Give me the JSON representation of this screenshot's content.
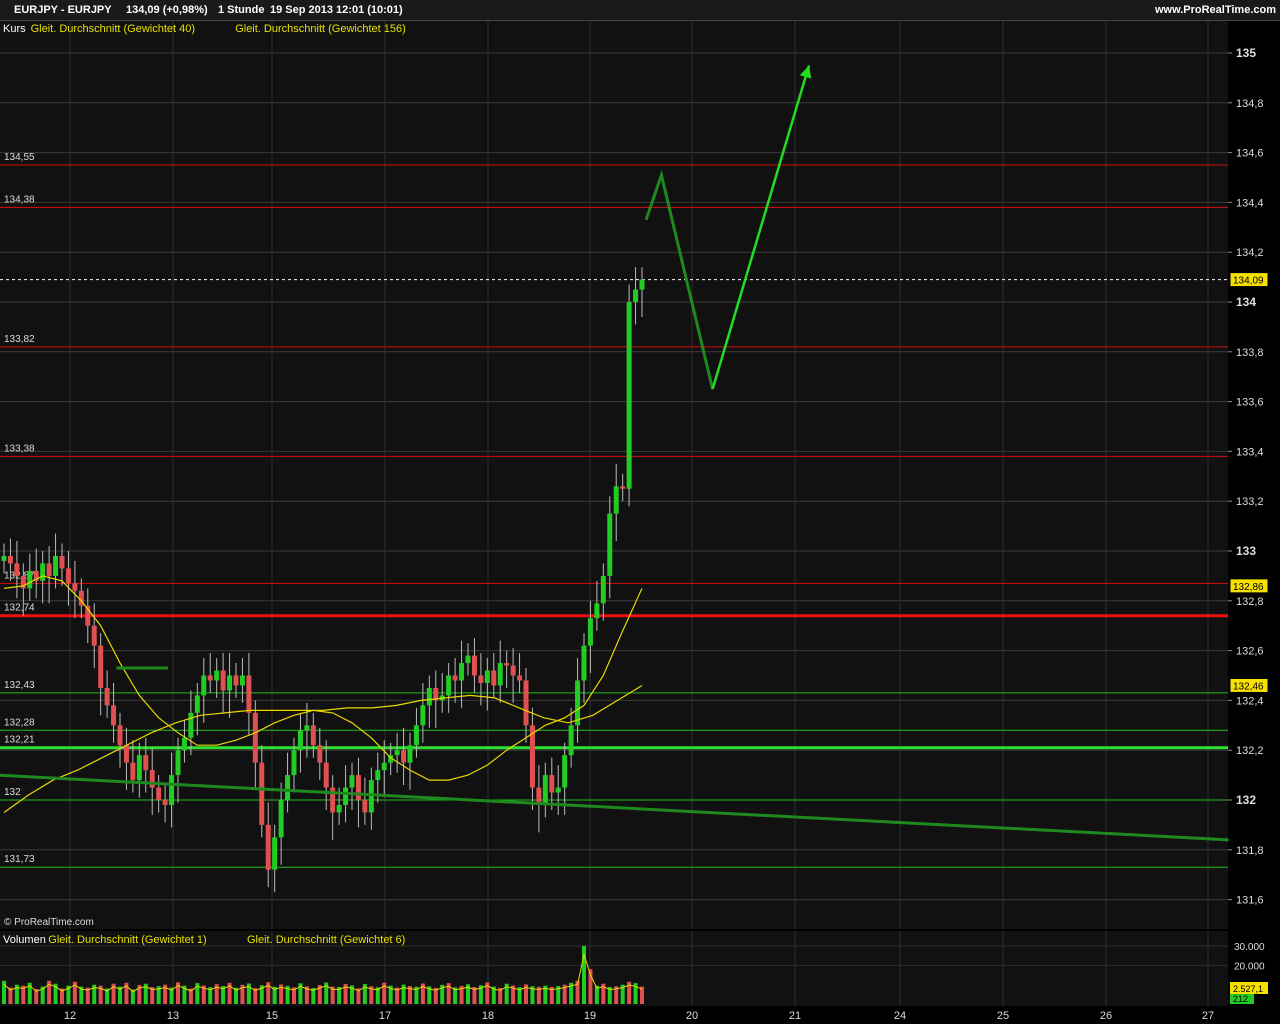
{
  "header": {
    "symbol": "EURJPY - EURJPY",
    "quote": "134,09 (+0,98%)",
    "period": "1 Stunde",
    "datetime": "19 Sep 2013 12:01 (10:01)",
    "brand": "www.ProRealTime.com"
  },
  "copyright": "© ProRealTime.com",
  "price_panel": {
    "legend": [
      {
        "text": "Kurs",
        "color": "#ffffff"
      },
      {
        "text": "Gleit. Durchschnitt (Gewichtet 40)",
        "color": "#e8e000"
      },
      {
        "text": "Gleit. Durchschnitt (Gewichtet 156)",
        "color": "#e8e000"
      }
    ],
    "y_ticks": [
      {
        "v": 135,
        "label": "135",
        "major": true
      },
      {
        "v": 134.8,
        "label": "134,8"
      },
      {
        "v": 134.6,
        "label": "134,6"
      },
      {
        "v": 134.4,
        "label": "134,4"
      },
      {
        "v": 134.2,
        "label": "134,2"
      },
      {
        "v": 134,
        "label": "134",
        "major": true
      },
      {
        "v": 133.8,
        "label": "133,8"
      },
      {
        "v": 133.6,
        "label": "133,6"
      },
      {
        "v": 133.4,
        "label": "133,4"
      },
      {
        "v": 133.2,
        "label": "133,2"
      },
      {
        "v": 133,
        "label": "133",
        "major": true
      },
      {
        "v": 132.8,
        "label": "132,8"
      },
      {
        "v": 132.6,
        "label": "132,6"
      },
      {
        "v": 132.4,
        "label": "132,4"
      },
      {
        "v": 132.2,
        "label": "132,2"
      },
      {
        "v": 132,
        "label": "132",
        "major": true
      },
      {
        "v": 131.8,
        "label": "131,8"
      },
      {
        "v": 131.6,
        "label": "131,6"
      }
    ],
    "price_tags": [
      {
        "v": 134.09,
        "label": "134,09",
        "bg": "#f5e000"
      },
      {
        "v": 132.86,
        "label": "132,86",
        "bg": "#f5e000"
      },
      {
        "v": 132.46,
        "label": "132,46",
        "bg": "#f5e000"
      }
    ],
    "current_price": 134.09
  },
  "volume_panel": {
    "legend": [
      {
        "text": "Volumen",
        "color": "#ffffff"
      },
      {
        "text": "Gleit. Durchschnitt (Gewichtet 1)",
        "color": "#e8e000"
      },
      {
        "text": "Gleit. Durchschnitt (Gewichtet 6)",
        "color": "#e8e000"
      }
    ],
    "y_ticks": [
      {
        "v": 30000,
        "label": "30.000"
      },
      {
        "v": 20000,
        "label": "20.000"
      }
    ],
    "tags": [
      "2.527,1",
      "212"
    ]
  },
  "x_axis": [
    {
      "label": "12",
      "day": 12
    },
    {
      "label": "13",
      "day": 13
    },
    {
      "label": "15",
      "day": 15
    },
    {
      "label": "17",
      "day": 17
    },
    {
      "label": "18",
      "day": 18
    },
    {
      "label": "19",
      "day": 19
    },
    {
      "label": "20",
      "day": 20
    },
    {
      "label": "21",
      "day": 21
    },
    {
      "label": "24",
      "day": 24
    },
    {
      "label": "25",
      "day": 25
    },
    {
      "label": "26",
      "day": 26
    },
    {
      "label": "27",
      "day": 27
    }
  ],
  "chart_data": {
    "type": "candlestick",
    "symbol": "EURJPY",
    "ylim": [
      131.5,
      135.2
    ],
    "grid": true,
    "horizontal_levels": [
      {
        "v": 134.55,
        "label": "134,55",
        "color": "#d01010",
        "width": 1
      },
      {
        "v": 134.38,
        "label": "134,38",
        "color": "#d01010",
        "width": 1
      },
      {
        "v": 133.82,
        "label": "133,82",
        "color": "#d01010",
        "width": 1
      },
      {
        "v": 133.38,
        "label": "133,38",
        "color": "#d01010",
        "width": 1
      },
      {
        "v": 132.87,
        "label": "132,87",
        "color": "#d01010",
        "width": 1
      },
      {
        "v": 132.74,
        "label": "132,74",
        "color": "#ee1010",
        "width": 3
      },
      {
        "v": 132.43,
        "label": "132,43",
        "color": "#20c020",
        "width": 1
      },
      {
        "v": 132.28,
        "label": "132,28",
        "color": "#20c020",
        "width": 1
      },
      {
        "v": 132.21,
        "label": "132,21",
        "color": "#30e030",
        "width": 3
      },
      {
        "v": 132,
        "label": "132",
        "color": "#20c020",
        "width": 1
      },
      {
        "v": 131.73,
        "label": "131,73",
        "color": "#20c020",
        "width": 1
      }
    ],
    "trendline": {
      "from": {
        "day": 11.3,
        "v": 132.1
      },
      "to": {
        "day": 27.2,
        "v": 131.84
      },
      "color": "#1e8a1e"
    },
    "projection_path": [
      {
        "day": 19.55,
        "v": 134.33
      },
      {
        "day": 19.7,
        "v": 134.51
      },
      {
        "day": 20.2,
        "v": 133.65
      },
      {
        "day": 21.4,
        "v": 134.95
      }
    ],
    "short_segment": {
      "from": {
        "day": 12.45,
        "v": 132.53
      },
      "to": {
        "day": 12.95,
        "v": 132.53
      }
    },
    "candles_close": [
      132.98,
      132.95,
      132.9,
      132.85,
      132.92,
      132.88,
      132.95,
      132.9,
      132.98,
      132.93,
      132.87,
      132.84,
      132.78,
      132.7,
      132.62,
      132.45,
      132.38,
      132.3,
      132.22,
      132.15,
      132.08,
      132.18,
      132.12,
      132.05,
      132.0,
      131.98,
      132.1,
      132.2,
      132.25,
      132.35,
      132.42,
      132.5,
      132.48,
      132.52,
      132.44,
      132.5,
      132.46,
      132.5,
      132.35,
      132.15,
      131.9,
      131.72,
      131.85,
      132.0,
      132.1,
      132.2,
      132.28,
      132.3,
      132.22,
      132.15,
      132.05,
      131.95,
      131.98,
      132.05,
      132.1,
      132.0,
      131.95,
      132.08,
      132.12,
      132.15,
      132.18,
      132.2,
      132.15,
      132.22,
      132.3,
      132.38,
      132.45,
      132.4,
      132.42,
      132.5,
      132.48,
      132.55,
      132.58,
      132.5,
      132.47,
      132.52,
      132.46,
      132.55,
      132.54,
      132.5,
      132.48,
      132.3,
      132.05,
      131.98,
      132.1,
      132.03,
      132.05,
      132.18,
      132.3,
      132.48,
      132.62,
      132.73,
      132.79,
      132.9,
      133.15,
      133.26,
      133.25,
      134.0,
      134.05,
      134.09
    ],
    "ma40": [
      132.85,
      132.86,
      132.9,
      132.88,
      132.8,
      132.7,
      132.55,
      132.42,
      132.33,
      132.27,
      132.22,
      132.22,
      132.24,
      132.27,
      132.31,
      132.34,
      132.36,
      132.35,
      132.31,
      132.25,
      132.17,
      132.12,
      132.08,
      132.08,
      132.1,
      132.14,
      132.2,
      132.25,
      132.3,
      132.33,
      132.38,
      132.5,
      132.68,
      132.85
    ],
    "ma156": [
      131.95,
      132.02,
      132.08,
      132.12,
      132.17,
      132.22,
      132.27,
      132.31,
      132.34,
      132.35,
      132.36,
      132.36,
      132.36,
      132.36,
      132.37,
      132.37,
      132.38,
      132.4,
      132.41,
      132.42,
      132.41,
      132.37,
      132.33,
      132.31,
      132.34,
      132.4,
      132.46
    ],
    "volume": [
      12000,
      8500,
      10000,
      9500,
      11000,
      7800,
      9000,
      12000,
      10500,
      8000,
      9500,
      11500,
      9000,
      8500,
      10000,
      9500,
      8000,
      10500,
      9000,
      11000,
      7500,
      9800,
      10500,
      8800,
      9200,
      10000,
      8500,
      11200,
      9500,
      8000,
      10800,
      9600,
      8700,
      10200,
      9300,
      11000,
      8400,
      9900,
      10600,
      8200,
      9700,
      11300,
      8900,
      10100,
      9400,
      8600,
      10700,
      9100,
      8300,
      9800,
      11100,
      9000,
      8800,
      10400,
      9600,
      8100,
      10300,
      9200,
      8700,
      11000,
      9500,
      8500,
      10000,
      9300,
      8900,
      10600,
      9100,
      8400,
      9900,
      10800,
      8600,
      9400,
      10200,
      8800,
      9700,
      11200,
      9000,
      8300,
      10500,
      9600,
      8700,
      10100,
      9200,
      8900,
      9500,
      8800,
      9300,
      10000,
      11000,
      12000,
      30000,
      18000,
      9500,
      10500,
      8800,
      9200,
      10000,
      11500,
      10800,
      9000
    ],
    "xlabel": "",
    "ylabel": ""
  }
}
